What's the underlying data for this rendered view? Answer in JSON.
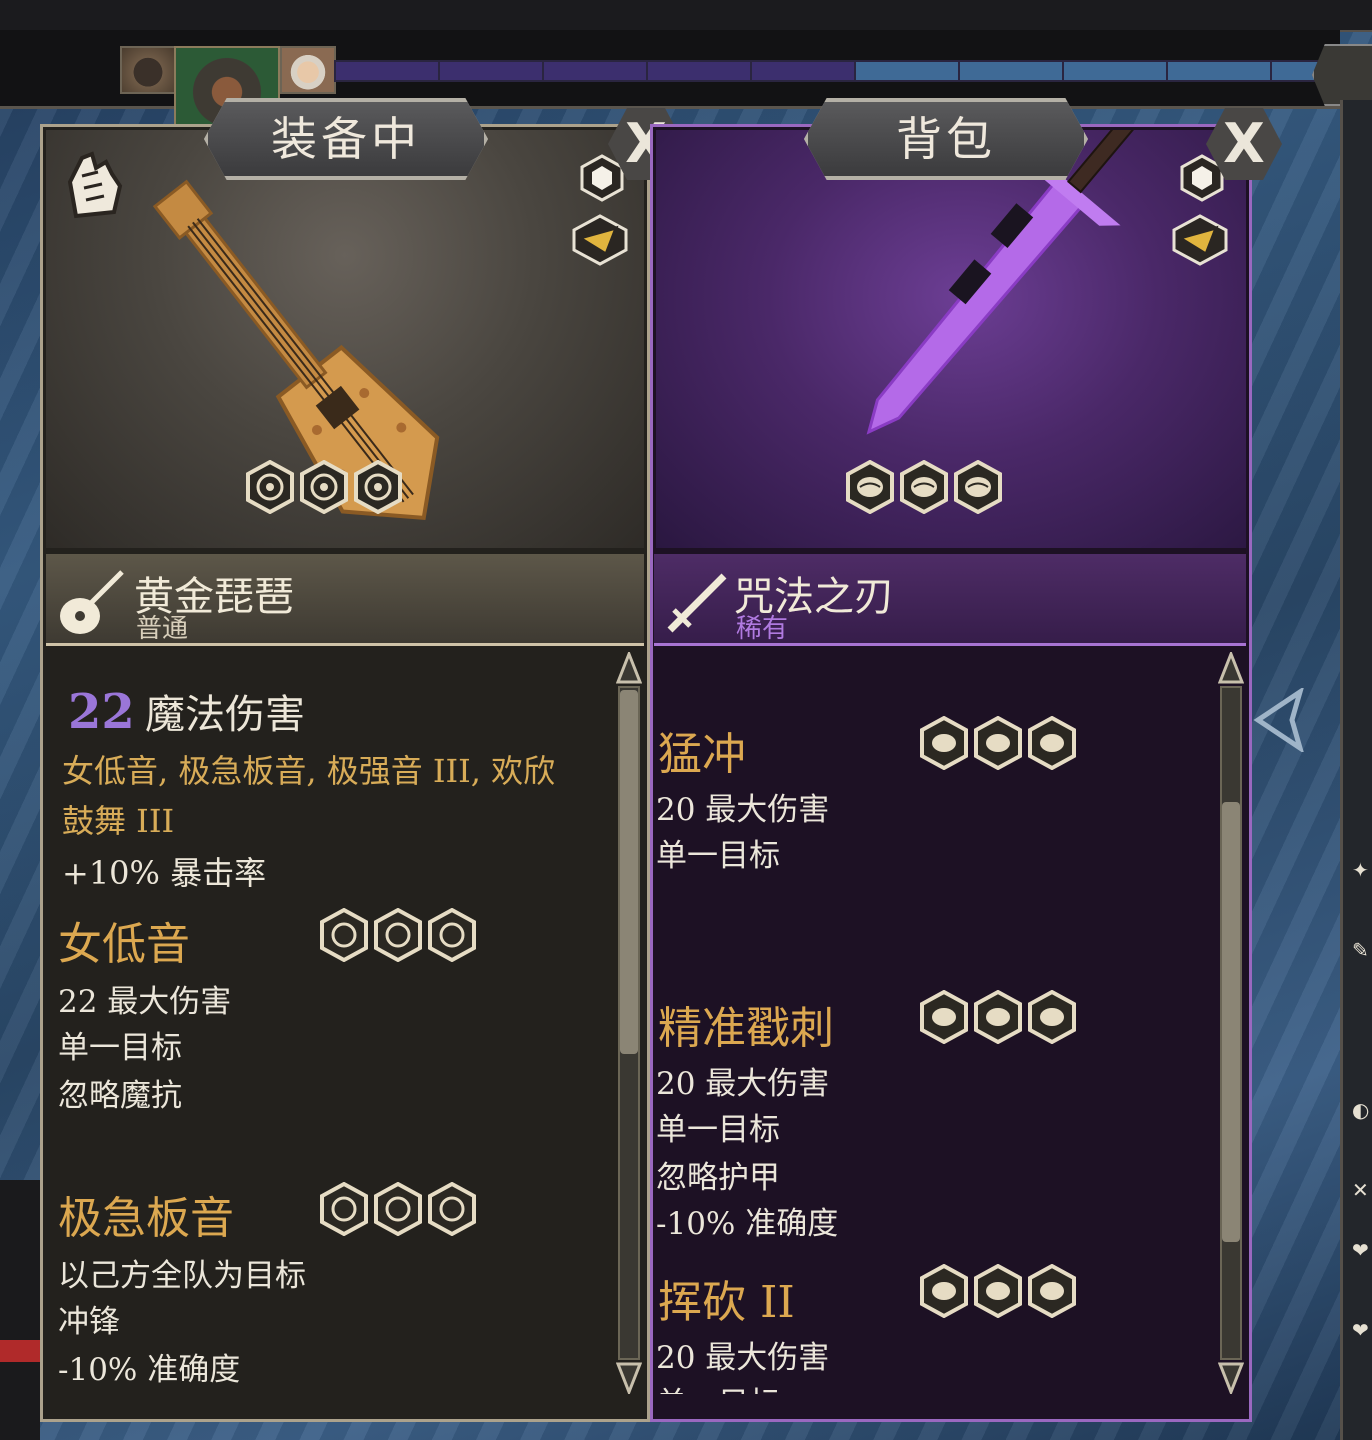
{
  "colors": {
    "common_border": "#aca28c",
    "rare_border": "#9a68c0",
    "gold_text": "#dca850",
    "rare_text": "#b07ae0",
    "damage_number": "#9a76d8"
  },
  "equipped_panel": {
    "tab_label": "装备中",
    "close_label": "X",
    "item_name": "黄金琵琶",
    "item_rarity": "普通",
    "damage_value": "22",
    "damage_label": "魔法伤害",
    "traits_line1": "女低音, 极急板音, 极强音 III, 欢欣",
    "traits_line2": "鼓舞 III",
    "crit_line": "+10% 暴击率",
    "abilities": [
      {
        "title": "女低音",
        "lines": [
          "22 最大伤害",
          "单一目标",
          "忽略魔抗"
        ]
      },
      {
        "title": "极急板音",
        "lines": [
          "以己方全队为目标",
          "冲锋",
          "-10% 准确度"
        ]
      }
    ],
    "icons": [
      "hand-grab-icon",
      "shield-hex-icon",
      "swap-arrow-icon",
      "music-symbol-icon"
    ]
  },
  "backpack_panel": {
    "tab_label": "背包",
    "close_label": "X",
    "item_name": "咒法之刃",
    "item_rarity": "稀有",
    "abilities": [
      {
        "title": "猛冲",
        "lines": [
          "20 最大伤害",
          "单一目标"
        ]
      },
      {
        "title": "精准戳刺",
        "lines": [
          "20 最大伤害",
          "单一目标",
          "忽略护甲",
          "-10% 准确度"
        ]
      },
      {
        "title": "挥砍 II",
        "lines": [
          "20 最大伤害",
          "单一目标"
        ]
      }
    ],
    "icons": [
      "shield-hex-icon",
      "swap-arrow-icon",
      "brain-symbol-icon"
    ]
  },
  "turn_order": {
    "segments_purple": 5,
    "segments_blue": 5
  }
}
